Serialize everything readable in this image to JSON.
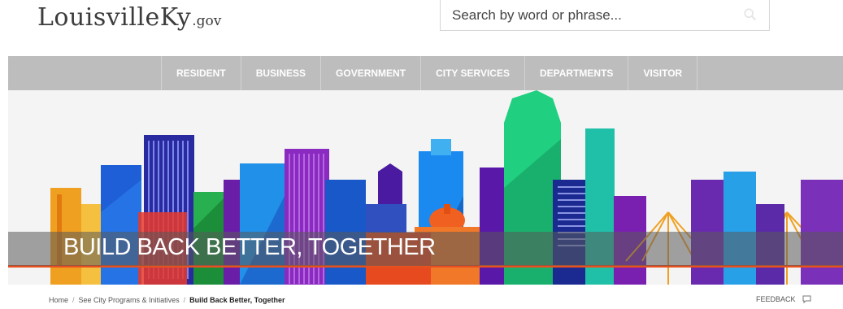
{
  "logo": {
    "main": "LouisvilleKy",
    "sub": ".gov"
  },
  "search": {
    "placeholder": "Search by word or phrase...",
    "icon": "search-icon"
  },
  "nav": {
    "items": [
      "RESIDENT",
      "BUSINESS",
      "GOVERNMENT",
      "CITY SERVICES",
      "DEPARTMENTS",
      "VISITOR"
    ]
  },
  "hero": {
    "title": "BUILD BACK BETTER, TOGETHER",
    "overlay_color": "#5a5a5a"
  },
  "breadcrumb": {
    "items": [
      "Home",
      "See City Programs & Initiatives"
    ],
    "separator": "/",
    "current": "Build Back Better, Together"
  },
  "feedback": {
    "label": "FEEDBACK",
    "icon": "comment-icon"
  },
  "colors": {
    "nav_bg": "#bdbdbd",
    "logo_text": "#3c3c3c"
  }
}
